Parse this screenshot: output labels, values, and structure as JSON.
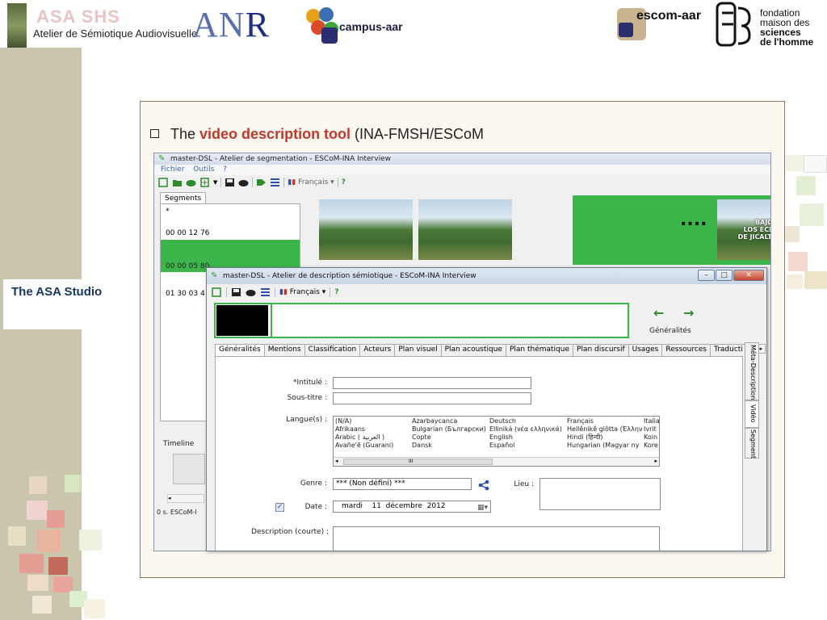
{
  "header": {
    "asa_title": "ASA SHS",
    "asa_subtitle": "Atelier de Sémiotique Audiovisuelle",
    "anr_left": "AN",
    "anr_right": "R",
    "campus_label": "campus-aar",
    "escom_label": "escom-aar",
    "fmsh_line1": "fondation",
    "fmsh_line2": "maison des",
    "fmsh_line3": "sciences",
    "fmsh_line4": "de l'homme"
  },
  "sidebar": {
    "studio_label": "The ASA Studio"
  },
  "slide": {
    "bullet_prefix": "The ",
    "bullet_highlight": "video description tool",
    "bullet_suffix": " (INA-FMSH/ESCoM"
  },
  "back_window": {
    "title": "master-DSL - Atelier de segmentation - ESCoM-INA Interview",
    "menu": [
      "Fichier",
      "Outils",
      "?"
    ],
    "language": "Français",
    "help": "?",
    "segments_tab": "Segments",
    "segments": [
      {
        "time": "*",
        "selected": false
      },
      {
        "time": "00 00 12 76",
        "selected": false
      },
      {
        "time": "00 00 05 80",
        "selected": true
      },
      {
        "time": "01 30 03 4",
        "selected": false
      }
    ],
    "thumb_caption": "BAJO\nLOS ECHOS\nDE JICALTEPEC",
    "dots": "....",
    "timeline_label": "Timeline",
    "status": "0 s.  ESCoM-I"
  },
  "front_window": {
    "title": "master-DSL - Atelier de description sémiotique - ESCoM-INA Interview",
    "language": "Français",
    "help": "?",
    "generalites_label": "Généralités",
    "tabs": [
      "Généralités",
      "Mentions",
      "Classification",
      "Acteurs",
      "Plan visuel",
      "Plan acoustique",
      "Plan thématique",
      "Plan discursif",
      "Usages",
      "Ressources",
      "Traducti"
    ],
    "side_tabs": [
      "Méta-Description",
      "Vidéo",
      "Segment"
    ],
    "form": {
      "intitule_label": "*Intitulé :",
      "soustitre_label": "Sous-titre :",
      "langues_label": "Langue(s) :",
      "genre_label": "Genre :",
      "genre_value": "*** (Non défini) ***",
      "lieu_label": "Lieu :",
      "date_label": "Date :",
      "date_value": "mardi    11  décembre  2012",
      "desc_label": "Description (courte) :",
      "languages": [
        [
          "(N/A)",
          "Afrikaans",
          "Arabic ( العربية )",
          "Avañe'ẽ (Guarani)"
        ],
        [
          "Azarbaycanca",
          "Bulgarian (Български)",
          "Copte",
          "Dansk"
        ],
        [
          "Deutsch",
          "Elliniká (νέα ελληνικά)",
          "English",
          "Español"
        ],
        [
          "Français",
          "Hellênikḗ glôtta (Ἑλλην",
          "Hindi (हिन्दी)",
          "Hungarian (Magyar ny"
        ],
        [
          "Italia",
          "Ivrit",
          "Koin",
          "Kore"
        ]
      ],
      "scroll_mark": "III"
    }
  },
  "colors": {
    "green": "#3cb54a",
    "title_red": "#c0392b",
    "frame_border": "#8c7a5a",
    "sidebar": "#c9c6ad"
  }
}
